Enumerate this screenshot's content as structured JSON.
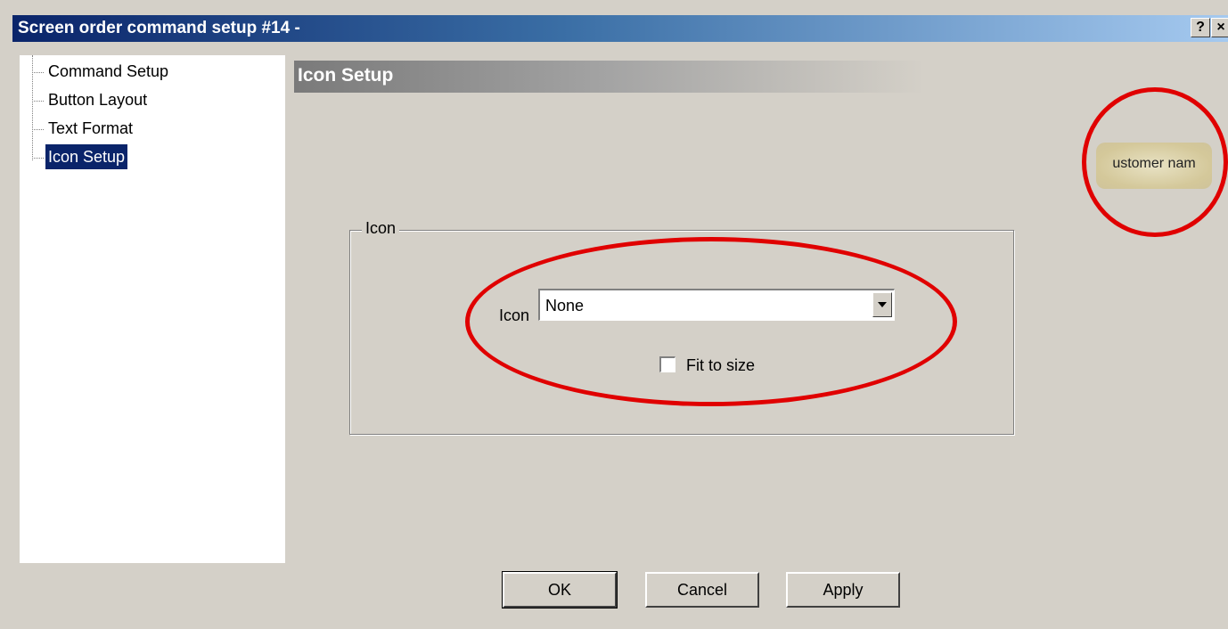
{
  "window": {
    "title": "Screen order command setup #14 -",
    "help_label": "?",
    "close_label": "×"
  },
  "tree": {
    "items": [
      {
        "label": "Command Setup",
        "selected": false
      },
      {
        "label": "Button Layout",
        "selected": false
      },
      {
        "label": "Text Format",
        "selected": false
      },
      {
        "label": "Icon Setup",
        "selected": true
      }
    ]
  },
  "section": {
    "title": "Icon Setup"
  },
  "preview": {
    "text": "ustomer nam"
  },
  "icon_group": {
    "legend": "Icon",
    "icon_label": "Icon",
    "icon_value": "None",
    "fit_label": "Fit to size",
    "fit_checked": false
  },
  "buttons": {
    "ok": "OK",
    "cancel": "Cancel",
    "apply": "Apply"
  },
  "colors": {
    "annotation": "#e00000",
    "selection": "#0a246a"
  }
}
